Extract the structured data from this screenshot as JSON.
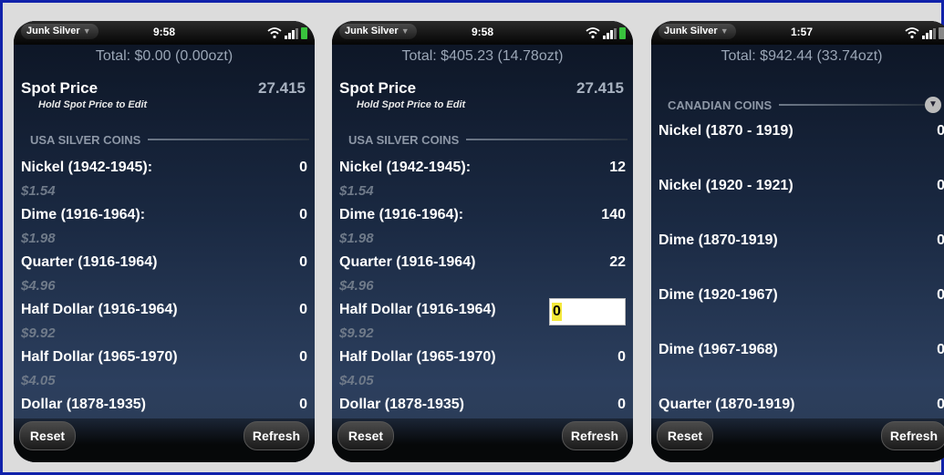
{
  "screens": [
    {
      "app_name": "Junk Silver",
      "time": "9:58",
      "total": "Total: $0.00 (0.00ozt)",
      "spot_title": "Spot Price",
      "spot_hint": "Hold Spot Price to Edit",
      "spot_value": "27.415",
      "section": "USA SILVER COINS",
      "rows": [
        {
          "label": "Nickel (1942-1945):",
          "qty": "0",
          "value": "$1.54"
        },
        {
          "label": "Dime (1916-1964):",
          "qty": "0",
          "value": "$1.98"
        },
        {
          "label": "Quarter (1916-1964)",
          "qty": "0",
          "value": "$4.96"
        },
        {
          "label": "Half Dollar (1916-1964)",
          "qty": "0",
          "value": "$9.92"
        },
        {
          "label": "Half Dollar (1965-1970)",
          "qty": "0",
          "value": "$4.05"
        },
        {
          "label": "Dollar (1878-1935)",
          "qty": "0"
        }
      ],
      "reset": "Reset",
      "refresh": "Refresh"
    },
    {
      "app_name": "Junk Silver",
      "time": "9:58",
      "total": "Total: $405.23 (14.78ozt)",
      "spot_title": "Spot Price",
      "spot_hint": "Hold Spot Price to Edit",
      "spot_value": "27.415",
      "section": "USA SILVER COINS",
      "rows": [
        {
          "label": "Nickel (1942-1945):",
          "qty": "12",
          "value": "$1.54"
        },
        {
          "label": "Dime (1916-1964):",
          "qty": "140",
          "value": "$1.98"
        },
        {
          "label": "Quarter (1916-1964)",
          "qty": "22",
          "value": "$4.96"
        },
        {
          "label": "Half Dollar (1916-1964)",
          "qty": "0",
          "value": "$9.92",
          "editing": true
        },
        {
          "label": "Half Dollar (1965-1970)",
          "qty": "0",
          "value": "$4.05"
        },
        {
          "label": "Dollar (1878-1935)",
          "qty": "0"
        }
      ],
      "reset": "Reset",
      "refresh": "Refresh"
    },
    {
      "app_name": "Junk Silver",
      "time": "1:57",
      "total": "Total: $942.44 (33.74ozt)",
      "section": "CANADIAN COINS",
      "rows": [
        {
          "label": "Nickel (1870 - 1919)",
          "qty": "0"
        },
        {
          "label": "Nickel (1920 - 1921)",
          "qty": "0"
        },
        {
          "label": "Dime (1870-1919)",
          "qty": "0"
        },
        {
          "label": "Dime (1920-1967)",
          "qty": "0"
        },
        {
          "label": "Dime (1967-1968)",
          "qty": "0"
        },
        {
          "label": "Quarter (1870-1919)",
          "qty": "0"
        }
      ],
      "reset": "Reset",
      "refresh": "Refresh"
    }
  ],
  "colors": {
    "frame_border": "#1122aa",
    "battery": "#39c23d",
    "input_highlight": "#f4e83a"
  },
  "icons": [
    "app-menu-caret-icon",
    "wifi-icon",
    "signal-icon",
    "battery-icon",
    "collapse-arrow-icon"
  ]
}
